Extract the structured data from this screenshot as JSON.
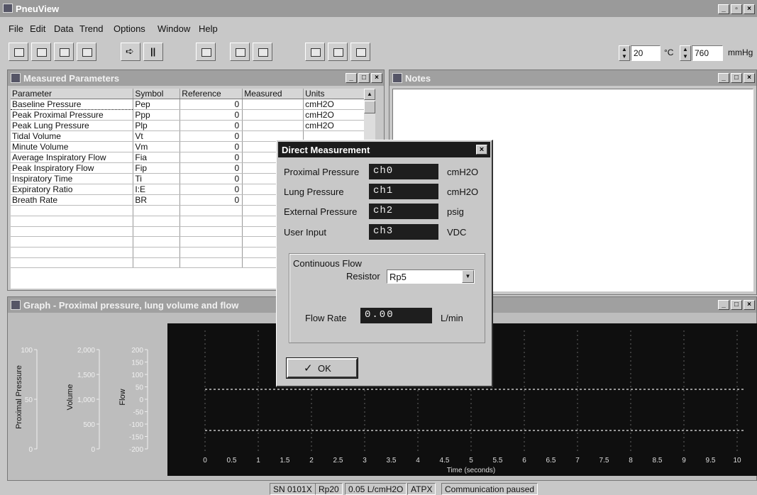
{
  "app": {
    "title": "PneuView"
  },
  "menu": [
    "File",
    "Edit",
    "Data",
    "Trend",
    "Options",
    "Window",
    "Help"
  ],
  "toolbar": {
    "temperature": "20",
    "temperature_unit": "°C",
    "pressure": "760",
    "pressure_unit": "mmHg"
  },
  "measured": {
    "title": "Measured Parameters",
    "columns": [
      "Parameter",
      "Symbol",
      "Reference",
      "Measured",
      "Units"
    ],
    "rows": [
      {
        "parameter": "Baseline Pressure",
        "symbol": "Pep",
        "reference": "0",
        "measured": "",
        "units": "cmH2O"
      },
      {
        "parameter": "Peak Proximal Pressure",
        "symbol": "Ppp",
        "reference": "0",
        "measured": "",
        "units": "cmH2O"
      },
      {
        "parameter": "Peak Lung Pressure",
        "symbol": "Plp",
        "reference": "0",
        "measured": "",
        "units": "cmH2O"
      },
      {
        "parameter": "Tidal Volume",
        "symbol": "Vt",
        "reference": "0",
        "measured": "",
        "units": ""
      },
      {
        "parameter": "Minute Volume",
        "symbol": "Vm",
        "reference": "0",
        "measured": "",
        "units": ""
      },
      {
        "parameter": "Average Inspiratory Flow",
        "symbol": "Fia",
        "reference": "0",
        "measured": "",
        "units": ""
      },
      {
        "parameter": "Peak Inspiratory Flow",
        "symbol": "Fip",
        "reference": "0",
        "measured": "",
        "units": ""
      },
      {
        "parameter": "Inspiratory Time",
        "symbol": "Ti",
        "reference": "0",
        "measured": "",
        "units": ""
      },
      {
        "parameter": "Expiratory Ratio",
        "symbol": "I:E",
        "reference": "0",
        "measured": "",
        "units": ""
      },
      {
        "parameter": "Breath Rate",
        "symbol": "BR",
        "reference": "0",
        "measured": "",
        "units": ""
      }
    ]
  },
  "notes": {
    "title": "Notes"
  },
  "graph": {
    "title": "Graph - Proximal pressure, lung volume and flow",
    "axes": {
      "proximal_pressure": {
        "label": "Proximal Pressure",
        "ticks": [
          "100",
          "50",
          "0"
        ]
      },
      "volume": {
        "label": "Volume",
        "ticks": [
          "2,000",
          "1,500",
          "1,000",
          "500",
          "0"
        ]
      },
      "flow": {
        "label": "Flow",
        "ticks": [
          "200",
          "150",
          "100",
          "50",
          "0",
          "-50",
          "-100",
          "-150",
          "-200"
        ]
      }
    },
    "x_ticks": [
      "0",
      "0.5",
      "1",
      "1.5",
      "2",
      "2.5",
      "3",
      "3.5",
      "4",
      "4.5",
      "5",
      "5.5",
      "6",
      "6.5",
      "7",
      "7.5",
      "8",
      "8.5",
      "9",
      "9.5",
      "10"
    ],
    "x_label": "Time (seconds)"
  },
  "dialog": {
    "title": "Direct Measurement",
    "rows": [
      {
        "label": "Proximal Pressure",
        "channel": "ch0",
        "unit": "cmH2O"
      },
      {
        "label": "Lung Pressure",
        "channel": "ch1",
        "unit": "cmH2O"
      },
      {
        "label": "External Pressure",
        "channel": "ch2",
        "unit": "psig"
      },
      {
        "label": "User Input",
        "channel": "ch3",
        "unit": "VDC"
      }
    ],
    "group_label": "Continuous Flow",
    "resistor_label": "Resistor",
    "resistor_value": "Rp5",
    "flow_rate_label": "Flow Rate",
    "flow_rate_value": "0.00",
    "flow_rate_unit": "L/min",
    "ok_label": "OK"
  },
  "status": [
    "SN 0101X",
    "Rp20",
    "0.05 L/cmH2O",
    "ATPX",
    "Communication paused"
  ]
}
